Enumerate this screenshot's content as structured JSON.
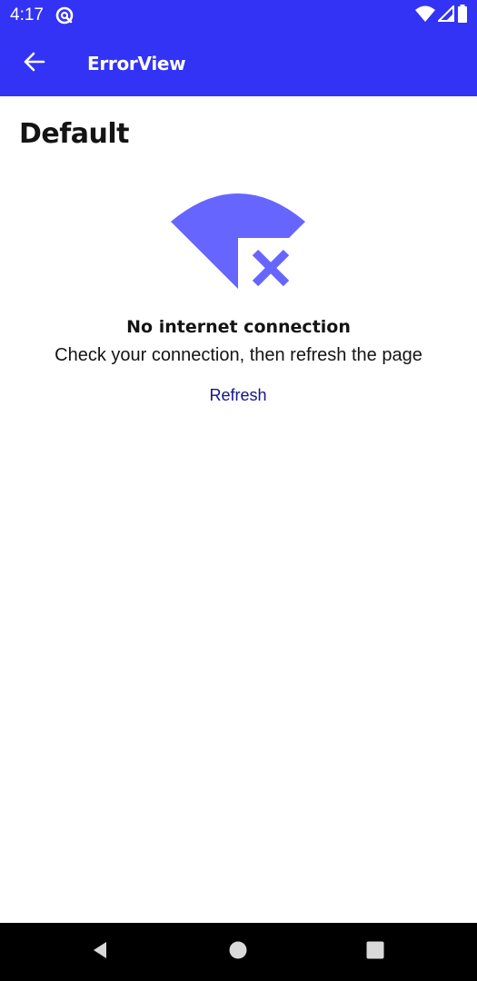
{
  "status_bar": {
    "time": "4:17",
    "icons": [
      "notification-at-icon",
      "wifi-icon",
      "signal-icon",
      "battery-icon"
    ]
  },
  "app_bar": {
    "title": "ErrorView",
    "back_icon": "arrow-back-icon",
    "background_color": "#3333f5"
  },
  "content": {
    "section_title": "Default",
    "illustration_icon": "wifi-off-icon",
    "illustration_color": "#6666ff",
    "error_title": "No internet connection",
    "error_message": "Check your connection, then refresh the page",
    "refresh_label": "Refresh",
    "link_color": "#14148a"
  },
  "nav_bar": {
    "buttons": [
      "back-triangle-icon",
      "home-circle-icon",
      "recents-square-icon"
    ]
  }
}
